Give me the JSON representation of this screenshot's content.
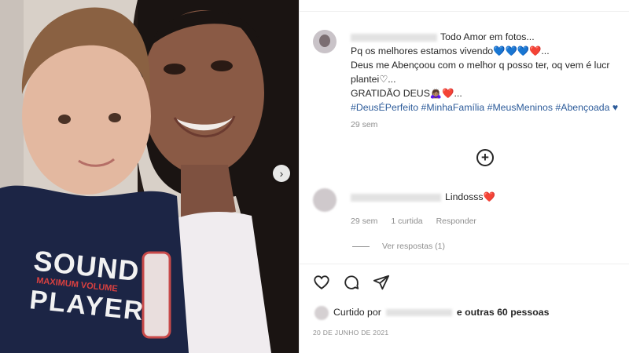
{
  "photo": {
    "shirt_text_main": "SOUND",
    "shirt_text_sub": "MAXIMUM VOLUME",
    "shirt_text_bottom": "PLAYER",
    "next_icon": "chevron-right-icon"
  },
  "post": {
    "caption": {
      "line1": "Todo Amor em fotos...",
      "line2": "Pq os melhores estamos vivendo",
      "line2_emoji": "💙💙💙",
      "line2_heart": "❤️",
      "line2_end": "...",
      "line3": "Deus me Abençoou com o melhor q posso ter, oq vem é lucr",
      "line4": "plantei♡...",
      "line5": "GRATIDÃO DEUS🙇🏽‍♀️",
      "line5_heart": "❤️",
      "line5_end": "...",
      "hashtags": "#DeusÉPerfeito #MinhaFamília #MeusMeninos #Abençoada ♥"
    },
    "time": "29 sem"
  },
  "comment": {
    "text": "Lindosss",
    "heart": "❤️",
    "time": "29 sem",
    "likes": "1 curtida",
    "reply": "Responder",
    "view_replies": "Ver respostas (1)"
  },
  "likes": {
    "prefix": "Curtido por",
    "suffix": "e outras 60 pessoas"
  },
  "date": "20 DE JUNHO DE 2021",
  "colors": {
    "blue_heart": "#1d5bbf",
    "red_heart": "#d61f3a",
    "hashtag": "#2c5b9a",
    "meta": "#8e8e8e"
  }
}
